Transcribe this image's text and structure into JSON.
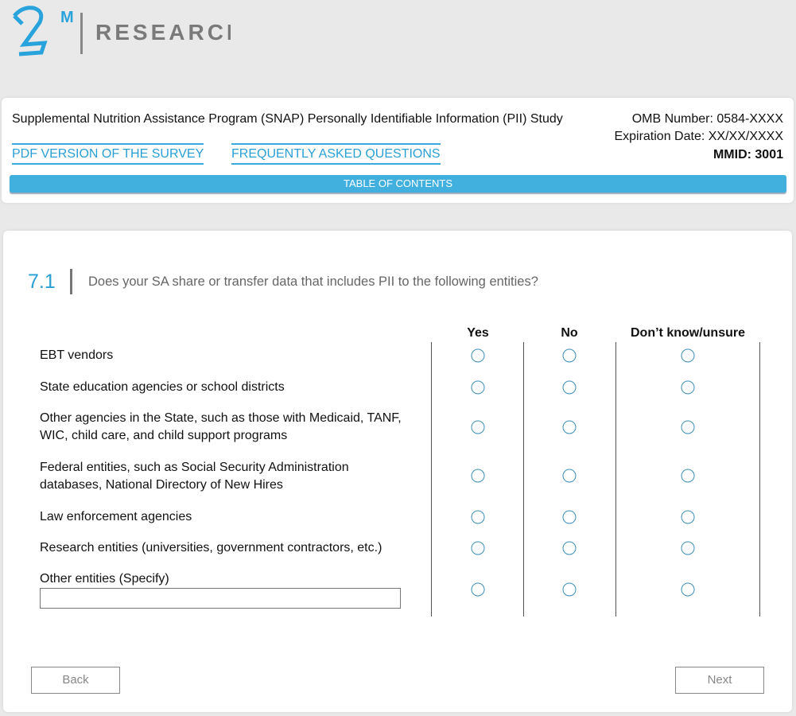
{
  "logo": {
    "mark": "2M",
    "text": "RESEARCH"
  },
  "header": {
    "title": "Supplemental Nutrition Assistance Program (SNAP) Personally Identifiable Information (PII) Study",
    "omb": "OMB Number: 0584-XXXX",
    "expiration": "Expiration Date: XX/XX/XXXX",
    "mmid": "MMID: 3001",
    "pdf_link": "PDF VERSION OF THE SURVEY",
    "faq_link": "FREQUENTLY ASKED QUESTIONS",
    "toc": "TABLE OF CONTENTS"
  },
  "question": {
    "number": "7.1",
    "text": "Does your SA share or transfer data that includes PII to the following entities?",
    "columns": [
      "Yes",
      "No",
      "Don’t know/unsure"
    ],
    "rows": [
      {
        "label": "EBT vendors"
      },
      {
        "label": "State education agencies or school districts"
      },
      {
        "label": "Other agencies in the State, such as those with Medicaid, TANF, WIC, child care, and child support programs"
      },
      {
        "label": "Federal entities, such as Social Security Administration databases, National Directory of New Hires"
      },
      {
        "label": "Law enforcement agencies"
      },
      {
        "label": "Research entities (universities, government contractors, etc.)"
      },
      {
        "label": "Other entities (Specify)"
      }
    ],
    "specify_value": ""
  },
  "nav": {
    "back": "Back",
    "next": "Next"
  },
  "colors": {
    "accent": "#42b0de",
    "link": "#2a9fd6"
  }
}
